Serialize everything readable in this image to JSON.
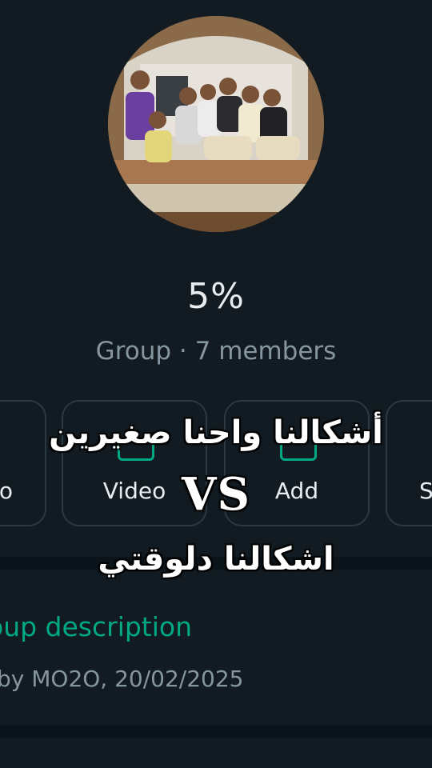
{
  "group": {
    "name": "5%",
    "meta": "Group · 7 members"
  },
  "actions": [
    {
      "id": "audio",
      "label": "o",
      "icon": "phone-icon"
    },
    {
      "id": "video",
      "label": "Video",
      "icon": "video-icon"
    },
    {
      "id": "add",
      "label": "Add",
      "icon": "add-person-icon"
    },
    {
      "id": "search",
      "label": "S",
      "icon": "search-icon"
    }
  ],
  "description": {
    "title": "oup description",
    "created": "by MO2O, 20/02/2025"
  },
  "overlay": {
    "top": "أشكالنا واحنا صغيرين",
    "vs": "VS",
    "bottom": "اشكالنا دلوقتي"
  },
  "colors": {
    "background": "#111b21",
    "accent": "#00a884",
    "muted": "#8696a0",
    "text": "#e9edef"
  }
}
